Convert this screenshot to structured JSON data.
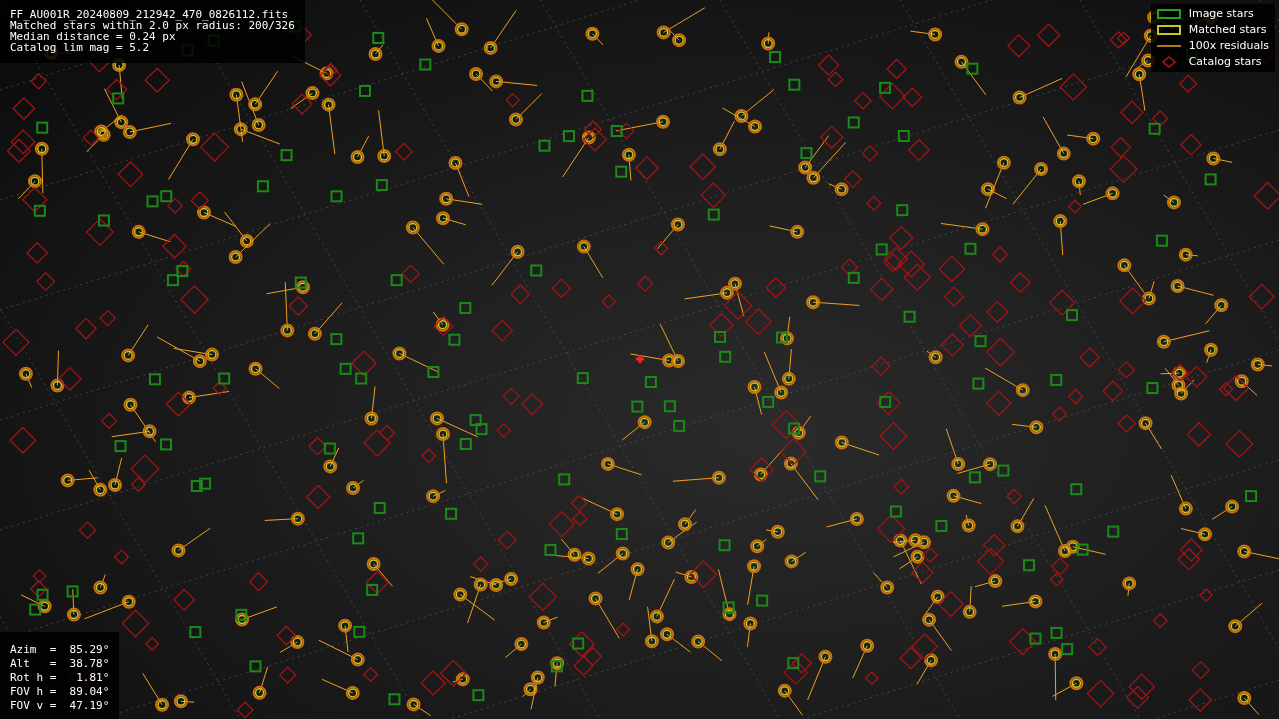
{
  "header_info": [
    "FF_AU001R_20240809_212942_470_0826112.fits",
    "Matched stars within 2.0 px radius: 200/326",
    "Median distance = 0.24 px",
    "Catalog lim mag = 5.2"
  ],
  "legend": [
    {
      "kind": "image",
      "label": "Image stars"
    },
    {
      "kind": "matched",
      "label": "Matched stars"
    },
    {
      "kind": "residual",
      "label": "100x residuals"
    },
    {
      "kind": "catalog",
      "label": "Catalog stars"
    }
  ],
  "pointing": [
    "Azim  =  85.29°",
    "Alt   =  38.78°",
    "Rot h =   1.81°",
    "FOV h =  89.04°",
    "FOV v =  47.19°"
  ]
}
